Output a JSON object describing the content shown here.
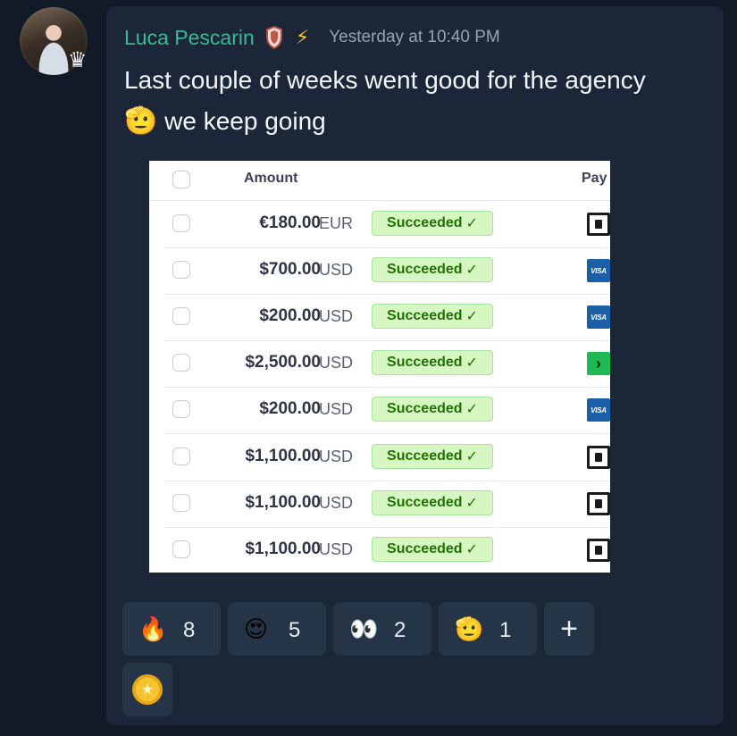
{
  "author": {
    "name": "Luca Pescarin",
    "avatar_icon": "avatar",
    "crown_icon": "crown-icon",
    "crown_glyph": "♛",
    "badge_icon": "shield-badge-icon",
    "bolt_glyph": "⚡"
  },
  "message": {
    "timestamp": "Yesterday at 10:40 PM",
    "text_before": "Last couple of weeks went good for the agency",
    "salute_glyph": "🫡",
    "text_after": " we keep going"
  },
  "payments_table": {
    "headers": {
      "amount": "Amount",
      "payment": "Pay"
    },
    "rows": [
      {
        "amount": "€180.00",
        "currency": "EUR",
        "status": "Succeeded",
        "payment_icon": "card-icon"
      },
      {
        "amount": "$700.00",
        "currency": "USD",
        "status": "Succeeded",
        "payment_icon": "visa-icon"
      },
      {
        "amount": "$200.00",
        "currency": "USD",
        "status": "Succeeded",
        "payment_icon": "visa-icon"
      },
      {
        "amount": "$2,500.00",
        "currency": "USD",
        "status": "Succeeded",
        "payment_icon": "link-icon"
      },
      {
        "amount": "$200.00",
        "currency": "USD",
        "status": "Succeeded",
        "payment_icon": "visa-icon"
      },
      {
        "amount": "$1,100.00",
        "currency": "USD",
        "status": "Succeeded",
        "payment_icon": "card-icon"
      },
      {
        "amount": "$1,100.00",
        "currency": "USD",
        "status": "Succeeded",
        "payment_icon": "card-icon"
      },
      {
        "amount": "$1,100.00",
        "currency": "USD",
        "status": "Succeeded",
        "payment_icon": "card-icon"
      }
    ],
    "check_glyph": "✓",
    "visa_text": "VISA",
    "link_glyph": "›"
  },
  "reactions": [
    {
      "emoji": "🔥",
      "count": "8",
      "icon": "fire-icon"
    },
    {
      "emoji": "😍",
      "count": "5",
      "icon": "heart-eyes-icon"
    },
    {
      "emoji": "👀",
      "count": "2",
      "icon": "eyes-icon"
    },
    {
      "emoji": "🫡",
      "count": "1",
      "icon": "salute-icon"
    }
  ],
  "add_reaction_glyph": "+",
  "coin_glyph": "★",
  "colors": {
    "background": "#111a26",
    "card": "#1b2738",
    "username": "#3bb894",
    "timestamp": "#97a3b3",
    "status_bg": "#d7f7c2",
    "status_text": "#217005"
  }
}
